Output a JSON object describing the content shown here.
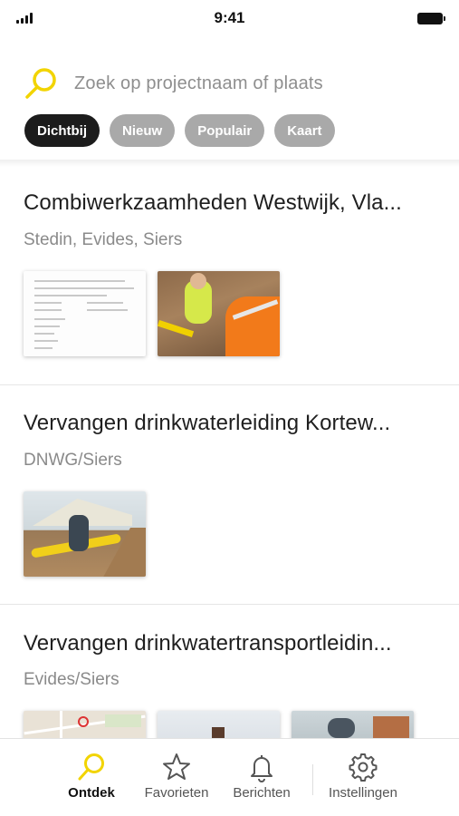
{
  "status_bar": {
    "time": "9:41"
  },
  "search": {
    "placeholder": "Zoek op projectnaam of plaats"
  },
  "filters": [
    {
      "label": "Dichtbij",
      "active": true
    },
    {
      "label": "Nieuw",
      "active": false
    },
    {
      "label": "Populair",
      "active": false
    },
    {
      "label": "Kaart",
      "active": false
    }
  ],
  "projects": [
    {
      "title": "Combiwerkzaamheden Westwijk, Vla...",
      "subtitle": "Stedin, Evides, Siers",
      "images": [
        "document-thumbnail",
        "worker-photo"
      ]
    },
    {
      "title": "Vervangen drinkwaterleiding Kortew...",
      "subtitle": "DNWG/Siers",
      "images": [
        "pipe-worker-photo"
      ]
    },
    {
      "title": "Vervangen drinkwatertransportleidin...",
      "subtitle": "Evides/Siers",
      "images": [
        "map-thumbnail",
        "street-photo",
        "trench-photo"
      ]
    }
  ],
  "tabbar": {
    "items": [
      {
        "label": "Ontdek",
        "icon": "search-icon",
        "active": true
      },
      {
        "label": "Favorieten",
        "icon": "star-icon",
        "active": false
      },
      {
        "label": "Berichten",
        "icon": "bell-icon",
        "active": false
      },
      {
        "label": "Instellingen",
        "icon": "gear-icon",
        "active": false
      }
    ]
  },
  "colors": {
    "accent": "#f2d400",
    "chip_active": "#1c1c1c",
    "chip_inactive": "#a9a9a9"
  }
}
